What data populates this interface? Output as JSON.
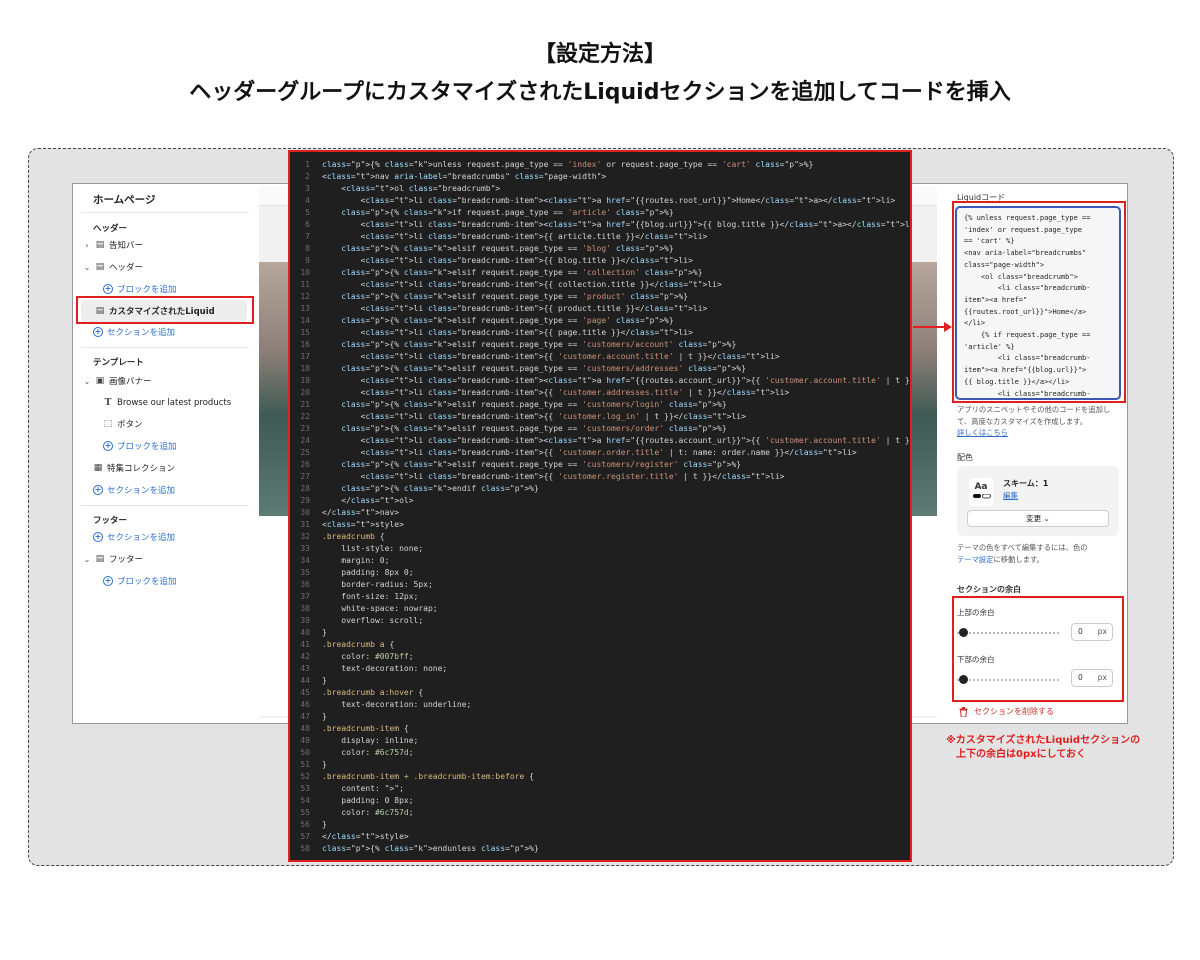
{
  "heading": {
    "line1": "【設定方法】",
    "line2": "ヘッダーグループにカスタマイズされたLiquidセクションを追加してコードを挿入"
  },
  "sidebar": {
    "title": "ホームページ",
    "header_group": "ヘッダー",
    "items_header": [
      {
        "chevron": ">",
        "label": "告知バー"
      },
      {
        "chevron": "v",
        "label": "ヘッダー"
      }
    ],
    "add_block_1": "ブロックを追加",
    "selected_item": "カスタマイズされたLiquid",
    "add_section_1": "セクションを追加",
    "template_group": "テンプレート",
    "image_banner": "画像バナー",
    "text_item": "Browse our latest products",
    "button_item": "ボタン",
    "add_block_2": "ブロックを追加",
    "featured_collection": "特集コレクション",
    "add_section_2": "セクションを追加",
    "footer_group": "フッター",
    "add_section_3": "セクションを追加",
    "footer_item": "フッター",
    "add_block_3": "ブロックを追加"
  },
  "right_panel": {
    "liquid_label": "Liquidコード",
    "liquid_code": "{% unless request.page_type ==\n'index' or request.page_type\n== 'cart' %}\n<nav aria-label=\"breadcrumbs\"\nclass=\"page-width\">\n    <ol class=\"breadcrumb\">\n        <li class=\"breadcrumb-\nitem\"><a href=\"\n{{routes.root_url}}\">Home</a>\n</li>\n    {% if request.page_type ==\n'article' %}\n        <li class=\"breadcrumb-\nitem\"><a href=\"{{blog.url}}\">\n{{ blog.title }}</a></li>\n        <li class=\"breadcrumb-",
    "help_text": "アプリのスニペットやその他のコードを追加して、高度なカスタマイズを作成します。",
    "help_link": "詳しくはこちら",
    "color_label": "配色",
    "scheme_aa": "Aa",
    "scheme_name": "スキーム：1",
    "scheme_edit": "編集",
    "change_button": "変更",
    "theme_text_1": "テーマの色をすべて編集するには、色の",
    "theme_link": "テーマ設定",
    "theme_text_2": "に移動します。",
    "padding_title": "セクションの余白",
    "top_padding_label": "上部の余白",
    "top_padding_value": "0",
    "bottom_padding_label": "下部の余白",
    "bottom_padding_value": "0",
    "unit": "px",
    "delete_label": "セクションを削除する"
  },
  "note": {
    "line1": "※カスタマイズされたLiquidセクションの",
    "line2": "上下の余白は0pxにしておく"
  },
  "code_lines": [
    {
      "n": "1",
      "text": "{% unless request.page_type == 'index' or request.page_type == 'cart' %}"
    },
    {
      "n": "2",
      "text": "<nav aria-label=\"breadcrumbs\" class=\"page-width\">"
    },
    {
      "n": "3",
      "text": "    <ol class=\"breadcrumb\">"
    },
    {
      "n": "4",
      "text": "        <li class=\"breadcrumb-item\"><a href=\"{{routes.root_url}}\">Home</a></li>"
    },
    {
      "n": "5",
      "text": "    {% if request.page_type == 'article' %}"
    },
    {
      "n": "6",
      "text": "        <li class=\"breadcrumb-item\"><a href=\"{{blog.url}}\">{{ blog.title }}</a></li>"
    },
    {
      "n": "7",
      "text": "        <li class=\"breadcrumb-item\">{{ article.title }}</li>"
    },
    {
      "n": "8",
      "text": "    {% elsif request.page_type == 'blog' %}"
    },
    {
      "n": "9",
      "text": "        <li class=\"breadcrumb-item\">{{ blog.title }}</li>"
    },
    {
      "n": "10",
      "text": "    {% elsif request.page_type == 'collection' %}"
    },
    {
      "n": "11",
      "text": "        <li class=\"breadcrumb-item\">{{ collection.title }}</li>"
    },
    {
      "n": "12",
      "text": "    {% elsif request.page_type == 'product' %}"
    },
    {
      "n": "13",
      "text": "        <li class=\"breadcrumb-item\">{{ product.title }}</li>"
    },
    {
      "n": "14",
      "text": "    {% elsif request.page_type == 'page' %}"
    },
    {
      "n": "15",
      "text": "        <li class=\"breadcrumb-item\">{{ page.title }}</li>"
    },
    {
      "n": "16",
      "text": "    {% elsif request.page_type == 'customers/account' %}"
    },
    {
      "n": "17",
      "text": "        <li class=\"breadcrumb-item\">{{ 'customer.account.title' | t }}</li>"
    },
    {
      "n": "18",
      "text": "    {% elsif request.page_type == 'customers/addresses' %}"
    },
    {
      "n": "19",
      "text": "        <li class=\"breadcrumb-item\"><a href=\"{{routes.account_url}}\">{{ 'customer.account.title' | t }}</a></li>"
    },
    {
      "n": "20",
      "text": "        <li class=\"breadcrumb-item\">{{ 'customer.addresses.title' | t }}</li>"
    },
    {
      "n": "21",
      "text": "    {% elsif request.page_type == 'customers/login' %}"
    },
    {
      "n": "22",
      "text": "        <li class=\"breadcrumb-item\">{{ 'customer.log_in' | t }}</li>"
    },
    {
      "n": "23",
      "text": "    {% elsif request.page_type == 'customers/order' %}"
    },
    {
      "n": "24",
      "text": "        <li class=\"breadcrumb-item\"><a href=\"{{routes.account_url}}\">{{ 'customer.account.title' | t }}</a></li>"
    },
    {
      "n": "25",
      "text": "        <li class=\"breadcrumb-item\">{{ 'customer.order.title' | t: name: order.name }}</li>"
    },
    {
      "n": "26",
      "text": "    {% elsif request.page_type == 'customers/register' %}"
    },
    {
      "n": "27",
      "text": "        <li class=\"breadcrumb-item\">{{ 'customer.register.title' | t }}</li>"
    },
    {
      "n": "28",
      "text": "    {% endif %}"
    },
    {
      "n": "29",
      "text": "    </ol>"
    },
    {
      "n": "30",
      "text": "</nav>"
    },
    {
      "n": "31",
      "text": "<style>"
    },
    {
      "n": "32",
      "text": ".breadcrumb {"
    },
    {
      "n": "33",
      "text": "    list-style: none;"
    },
    {
      "n": "34",
      "text": "    margin: 0;"
    },
    {
      "n": "35",
      "text": "    padding: 8px 0;"
    },
    {
      "n": "36",
      "text": "    border-radius: 5px;"
    },
    {
      "n": "37",
      "text": "    font-size: 12px;"
    },
    {
      "n": "38",
      "text": "    white-space: nowrap;"
    },
    {
      "n": "39",
      "text": "    overflow: scroll;"
    },
    {
      "n": "40",
      "text": "}"
    },
    {
      "n": "41",
      "text": ".breadcrumb a {"
    },
    {
      "n": "42",
      "text": "    color: #007bff;"
    },
    {
      "n": "43",
      "text": "    text-decoration: none;"
    },
    {
      "n": "44",
      "text": "}"
    },
    {
      "n": "45",
      "text": ".breadcrumb a:hover {"
    },
    {
      "n": "46",
      "text": "    text-decoration: underline;"
    },
    {
      "n": "47",
      "text": "}"
    },
    {
      "n": "48",
      "text": ".breadcrumb-item {"
    },
    {
      "n": "49",
      "text": "    display: inline;"
    },
    {
      "n": "50",
      "text": "    color: #6c757d;"
    },
    {
      "n": "51",
      "text": "}"
    },
    {
      "n": "52",
      "text": ".breadcrumb-item + .breadcrumb-item:before {"
    },
    {
      "n": "53",
      "text": "    content: \">\";"
    },
    {
      "n": "54",
      "text": "    padding: 0 8px;"
    },
    {
      "n": "55",
      "text": "    color: #6c757d;"
    },
    {
      "n": "56",
      "text": "}"
    },
    {
      "n": "57",
      "text": "</style>"
    },
    {
      "n": "58",
      "text": "{% endunless %}"
    }
  ],
  "colors": {
    "highlight_red": "#e02020",
    "link_blue": "#2c6ecb",
    "code_bg": "#1f1f1f",
    "textarea_border": "#3a58b5"
  }
}
